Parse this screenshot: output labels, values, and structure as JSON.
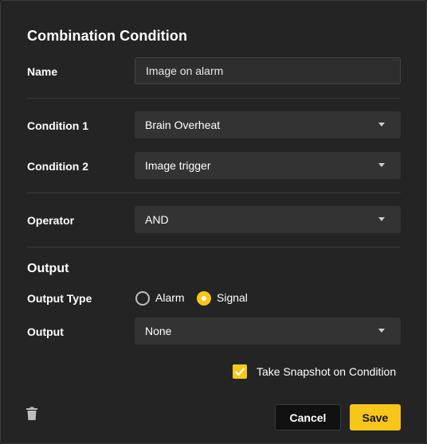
{
  "dialog": {
    "title": "Combination Condition",
    "name": {
      "label": "Name",
      "value": "Image on alarm"
    },
    "condition1": {
      "label": "Condition 1",
      "value": "Brain Overheat"
    },
    "condition2": {
      "label": "Condition 2",
      "value": "Image trigger"
    },
    "operator": {
      "label": "Operator",
      "value": "AND"
    },
    "output_section": {
      "heading": "Output",
      "type_label": "Output Type",
      "type_options": [
        {
          "label": "Alarm",
          "selected": false
        },
        {
          "label": "Signal",
          "selected": true
        }
      ],
      "output_label": "Output",
      "output_value": "None"
    },
    "snapshot": {
      "label": "Take Snapshot on Condition",
      "checked": true
    },
    "buttons": {
      "cancel": "Cancel",
      "save": "Save"
    },
    "icons": {
      "delete": "trash-icon",
      "dropdown": "chevron-down-icon",
      "check": "check-icon"
    },
    "colors": {
      "accent": "#f7c619",
      "background": "#242424",
      "field": "#333333"
    }
  }
}
